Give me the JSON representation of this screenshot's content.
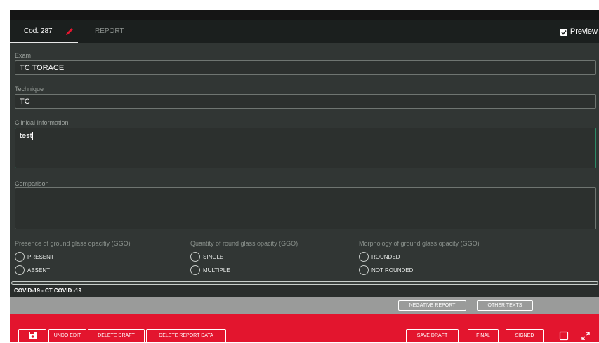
{
  "tabs": {
    "cod_label": "Cod. 287",
    "report_label": "REPORT"
  },
  "preview": {
    "label": "Preview",
    "checked": true
  },
  "form": {
    "exam": {
      "label": "Exam",
      "value": "TC TORACE"
    },
    "technique": {
      "label": "Technique",
      "value": "TC"
    },
    "clinical": {
      "label": "Clinical Information",
      "value": "test"
    },
    "comparison": {
      "label": "Comparison",
      "value": ""
    }
  },
  "radio_groups": [
    {
      "title": "Presence of ground glass opacitiy (GGO)",
      "options": [
        "PRESENT",
        "ABSENT"
      ]
    },
    {
      "title": "Quantity of round glass opacity (GGO)",
      "options": [
        "SINGLE",
        "MULTIPLE"
      ]
    },
    {
      "title": "Morphology of ground glass opacity (GGO)",
      "options": [
        "ROUNDED",
        "NOT ROUNDED"
      ]
    }
  ],
  "template_title": "COVID-19 - CT COVID -19",
  "gray_buttons": {
    "negative": "NEGATIVE REPORT",
    "other": "OTHER TEXTS"
  },
  "red_buttons": {
    "undo": "UNDO EDIT",
    "delete_draft": "DELETE DRAFT",
    "delete_report_data": "DELETE REPORT DATA",
    "save_draft": "SAVE DRAFT",
    "final": "FINAL",
    "signed": "SIGNED"
  },
  "icons": [
    "pencil-icon",
    "check-icon",
    "save-icon",
    "note-icon",
    "expand-icon"
  ],
  "colors": {
    "accent_red": "#e3152e",
    "active_border": "#2e8a67",
    "pencil": "#e3152e"
  }
}
